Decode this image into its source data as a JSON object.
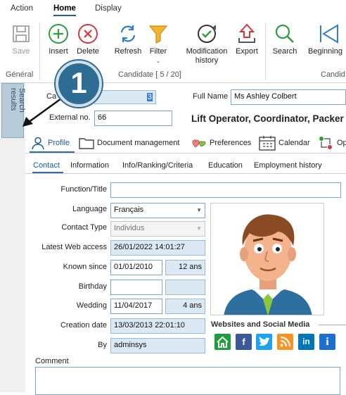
{
  "menu": {
    "tabs": [
      {
        "label": "Action"
      },
      {
        "label": "Home"
      },
      {
        "label": "Display"
      }
    ]
  },
  "ribbon": {
    "save": "Save",
    "insert": "Insert",
    "delete": "Delete",
    "refresh": "Refresh",
    "filter": "Filter",
    "modification_history": "Modification history",
    "export": "Export",
    "search": "Search",
    "beginning": "Beginning",
    "group_general": "Général",
    "group_candidate": "Candidate [ 5 / 20]",
    "group_candid_cut": "Candid"
  },
  "sidebar": {
    "search_results": "Search results"
  },
  "callout": {
    "number": "1"
  },
  "header": {
    "candidate_label": "Ca",
    "candidate_value": "3",
    "full_name_label": "Full Name",
    "full_name_value": "Ms Ashley Colbert",
    "external_label": "External no.",
    "external_value": "66",
    "role": "Lift Operator, Coordinator, Packer"
  },
  "tabs": [
    {
      "label": "Profile"
    },
    {
      "label": "Document management"
    },
    {
      "label": "Preferences"
    },
    {
      "label": "Calendar"
    },
    {
      "label": "Op"
    }
  ],
  "subtabs": [
    {
      "label": "Contact"
    },
    {
      "label": "Information"
    },
    {
      "label": "Info/Ranking/Criteria"
    },
    {
      "label": "Education"
    },
    {
      "label": "Employment history"
    }
  ],
  "form": {
    "function_label": "Function/Title",
    "function_value": "",
    "language_label": "Language",
    "language_value": "Français",
    "contact_type_label": "Contact Type",
    "contact_type_value": "Individus",
    "last_web_label": "Latest Web access",
    "last_web_value": "26/01/2022 14:01:27",
    "known_since_label": "Known since",
    "known_since_value": "01/01/2010",
    "known_since_years": "12 ans",
    "birthday_label": "Birthday",
    "birthday_value": "",
    "birthday_years": "",
    "wedding_label": "Wedding",
    "wedding_value": "11/04/2017",
    "wedding_years": "4 ans",
    "creation_label": "Creation date",
    "creation_value": "13/03/2013 22:01:10",
    "by_label": "By",
    "by_value": "adminsys",
    "comment_label": "Comment"
  },
  "websites": {
    "title": "Websites and Social Media"
  }
}
